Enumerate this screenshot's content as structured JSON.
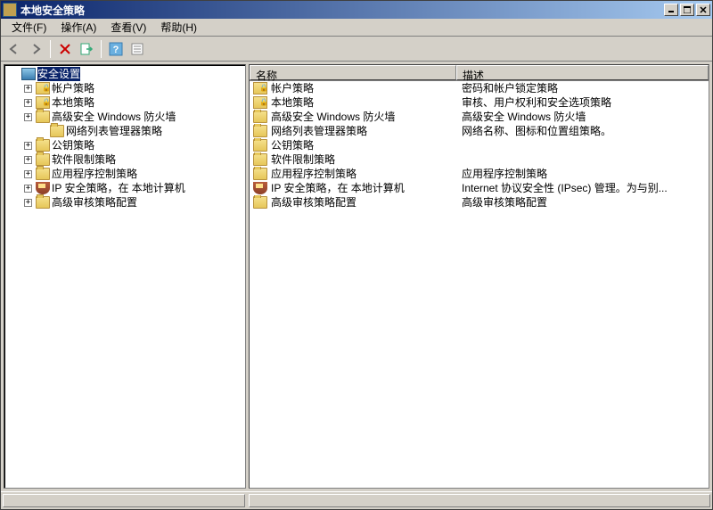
{
  "window": {
    "title": "本地安全策略"
  },
  "menu": {
    "file": "文件(F)",
    "action": "操作(A)",
    "view": "查看(V)",
    "help": "帮助(H)"
  },
  "tree": {
    "root": "安全设置",
    "items": [
      {
        "label": "帐户策略",
        "icon": "folder-lock",
        "expandable": true
      },
      {
        "label": "本地策略",
        "icon": "folder-lock",
        "expandable": true
      },
      {
        "label": "高级安全 Windows 防火墙",
        "icon": "folder",
        "expandable": true
      },
      {
        "label": "网络列表管理器策略",
        "icon": "folder",
        "expandable": false,
        "depth": 2
      },
      {
        "label": "公钥策略",
        "icon": "folder",
        "expandable": true
      },
      {
        "label": "软件限制策略",
        "icon": "folder",
        "expandable": true
      },
      {
        "label": "应用程序控制策略",
        "icon": "folder",
        "expandable": true
      },
      {
        "label": "IP 安全策略，在 本地计算机",
        "icon": "shield",
        "expandable": true
      },
      {
        "label": "高级审核策略配置",
        "icon": "folder",
        "expandable": true
      }
    ]
  },
  "list": {
    "header_name": "名称",
    "header_desc": "描述",
    "rows": [
      {
        "name": "帐户策略",
        "desc": "密码和帐户锁定策略",
        "icon": "folder-lock"
      },
      {
        "name": "本地策略",
        "desc": "审核、用户权利和安全选项策略",
        "icon": "folder-lock"
      },
      {
        "name": "高级安全 Windows 防火墙",
        "desc": "高级安全 Windows 防火墙",
        "icon": "folder"
      },
      {
        "name": "网络列表管理器策略",
        "desc": "网络名称、图标和位置组策略。",
        "icon": "folder"
      },
      {
        "name": "公钥策略",
        "desc": "",
        "icon": "folder"
      },
      {
        "name": "软件限制策略",
        "desc": "",
        "icon": "folder"
      },
      {
        "name": "应用程序控制策略",
        "desc": "应用程序控制策略",
        "icon": "folder"
      },
      {
        "name": "IP 安全策略，在 本地计算机",
        "desc": "Internet 协议安全性 (IPsec) 管理。为与别...",
        "icon": "shield"
      },
      {
        "name": "高级审核策略配置",
        "desc": "高级审核策略配置",
        "icon": "folder"
      }
    ]
  }
}
